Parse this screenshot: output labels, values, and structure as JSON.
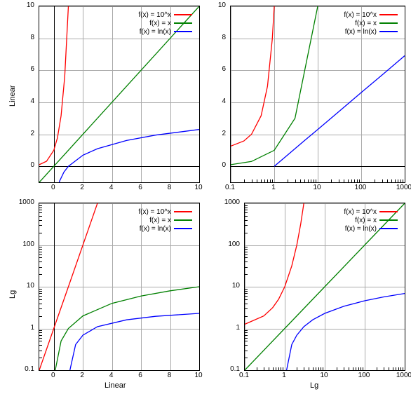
{
  "axis_labels": {
    "linear": "Linear",
    "lg": "Lg"
  },
  "legend": {
    "items": [
      {
        "label": "f(x) = 10^x",
        "color": "#ff0000"
      },
      {
        "label": "f(x) = x",
        "color": "#008000"
      },
      {
        "label": "f(x) = ln(x)",
        "color": "#0000ff"
      }
    ]
  },
  "chart_data": [
    {
      "id": "top-left",
      "x_scale": "linear",
      "y_scale": "linear",
      "xlim": [
        -1,
        10
      ],
      "ylim": [
        -1,
        10
      ],
      "xticks": [
        0,
        2,
        4,
        6,
        8,
        10
      ],
      "yticks": [
        0,
        2,
        4,
        6,
        8,
        10
      ],
      "xlabel": "",
      "ylabel": "Linear",
      "series": [
        {
          "name": "f(x) = 10^x",
          "color": "#ff0000",
          "points": [
            [
              -1,
              0.1
            ],
            [
              -0.5,
              0.316
            ],
            [
              0,
              1
            ],
            [
              0.25,
              1.78
            ],
            [
              0.5,
              3.16
            ],
            [
              0.75,
              5.62
            ],
            [
              1,
              10
            ]
          ]
        },
        {
          "name": "f(x) = x",
          "color": "#008000",
          "points": [
            [
              -1,
              -1
            ],
            [
              10,
              10
            ]
          ]
        },
        {
          "name": "f(x) = ln(x)",
          "color": "#0000ff",
          "points": [
            [
              0.05,
              -3
            ],
            [
              0.1,
              -2.3
            ],
            [
              0.2,
              -1.61
            ],
            [
              0.4,
              -0.92
            ],
            [
              0.7,
              -0.36
            ],
            [
              1,
              0
            ],
            [
              2,
              0.69
            ],
            [
              3,
              1.1
            ],
            [
              5,
              1.61
            ],
            [
              7,
              1.95
            ],
            [
              10,
              2.3
            ]
          ]
        }
      ]
    },
    {
      "id": "top-right",
      "x_scale": "log",
      "y_scale": "linear",
      "xlim": [
        0.1,
        1000
      ],
      "ylim": [
        -1,
        10
      ],
      "xticks": [
        0.1,
        1,
        10,
        100,
        1000
      ],
      "yticks": [
        0,
        2,
        4,
        6,
        8,
        10
      ],
      "xlabel": "",
      "ylabel": "",
      "series": [
        {
          "name": "f(x) = 10^x",
          "color": "#ff0000",
          "points": [
            [
              0.1,
              1.26
            ],
            [
              0.2,
              1.58
            ],
            [
              0.3,
              2.0
            ],
            [
              0.5,
              3.16
            ],
            [
              0.7,
              5.01
            ],
            [
              0.9,
              7.94
            ],
            [
              1,
              10
            ]
          ]
        },
        {
          "name": "f(x) = x",
          "color": "#008000",
          "points": [
            [
              0.1,
              0.1
            ],
            [
              0.3,
              0.3
            ],
            [
              1,
              1
            ],
            [
              3,
              3
            ],
            [
              10,
              10
            ]
          ]
        },
        {
          "name": "f(x) = ln(x)",
          "color": "#0000ff",
          "points": [
            [
              1,
              0
            ],
            [
              2,
              0.69
            ],
            [
              5,
              1.61
            ],
            [
              10,
              2.3
            ],
            [
              30,
              3.4
            ],
            [
              100,
              4.61
            ],
            [
              300,
              5.7
            ],
            [
              1000,
              6.91
            ]
          ]
        }
      ]
    },
    {
      "id": "bottom-left",
      "x_scale": "linear",
      "y_scale": "log",
      "xlim": [
        -1,
        10
      ],
      "ylim": [
        0.1,
        1000
      ],
      "xticks": [
        0,
        2,
        4,
        6,
        8,
        10
      ],
      "yticks": [
        0.1,
        1,
        10,
        100,
        1000
      ],
      "xlabel": "Linear",
      "ylabel": "Lg",
      "series": [
        {
          "name": "f(x) = 10^x",
          "color": "#ff0000",
          "points": [
            [
              -1,
              0.1
            ],
            [
              0,
              1
            ],
            [
              1,
              10
            ],
            [
              2,
              100
            ],
            [
              3,
              1000
            ]
          ]
        },
        {
          "name": "f(x) = x",
          "color": "#008000",
          "points": [
            [
              0.1,
              0.1
            ],
            [
              0.5,
              0.5
            ],
            [
              1,
              1
            ],
            [
              2,
              2
            ],
            [
              4,
              4
            ],
            [
              6,
              6
            ],
            [
              8,
              8
            ],
            [
              10,
              10
            ]
          ]
        },
        {
          "name": "f(x) = ln(x)",
          "color": "#0000ff",
          "points": [
            [
              1.11,
              0.1
            ],
            [
              1.5,
              0.41
            ],
            [
              2,
              0.69
            ],
            [
              3,
              1.1
            ],
            [
              5,
              1.61
            ],
            [
              7,
              1.95
            ],
            [
              10,
              2.3
            ]
          ]
        }
      ]
    },
    {
      "id": "bottom-right",
      "x_scale": "log",
      "y_scale": "log",
      "xlim": [
        0.1,
        1000
      ],
      "ylim": [
        0.1,
        1000
      ],
      "xticks": [
        0.1,
        1,
        10,
        100,
        1000
      ],
      "yticks": [
        0.1,
        1,
        10,
        100,
        1000
      ],
      "xlabel": "Lg",
      "ylabel": "",
      "series": [
        {
          "name": "f(x) = 10^x",
          "color": "#ff0000",
          "points": [
            [
              0.1,
              1.26
            ],
            [
              0.3,
              2.0
            ],
            [
              0.5,
              3.16
            ],
            [
              0.7,
              5.01
            ],
            [
              1,
              10
            ],
            [
              1.5,
              31.6
            ],
            [
              2,
              100
            ],
            [
              2.5,
              316
            ],
            [
              3,
              1000
            ]
          ]
        },
        {
          "name": "f(x) = x",
          "color": "#008000",
          "points": [
            [
              0.1,
              0.1
            ],
            [
              1,
              1
            ],
            [
              10,
              10
            ],
            [
              100,
              100
            ],
            [
              1000,
              1000
            ]
          ]
        },
        {
          "name": "f(x) = ln(x)",
          "color": "#0000ff",
          "points": [
            [
              1.11,
              0.1
            ],
            [
              1.5,
              0.41
            ],
            [
              2,
              0.69
            ],
            [
              3,
              1.1
            ],
            [
              5,
              1.61
            ],
            [
              10,
              2.3
            ],
            [
              30,
              3.4
            ],
            [
              100,
              4.61
            ],
            [
              300,
              5.7
            ],
            [
              1000,
              6.91
            ]
          ]
        }
      ]
    }
  ]
}
